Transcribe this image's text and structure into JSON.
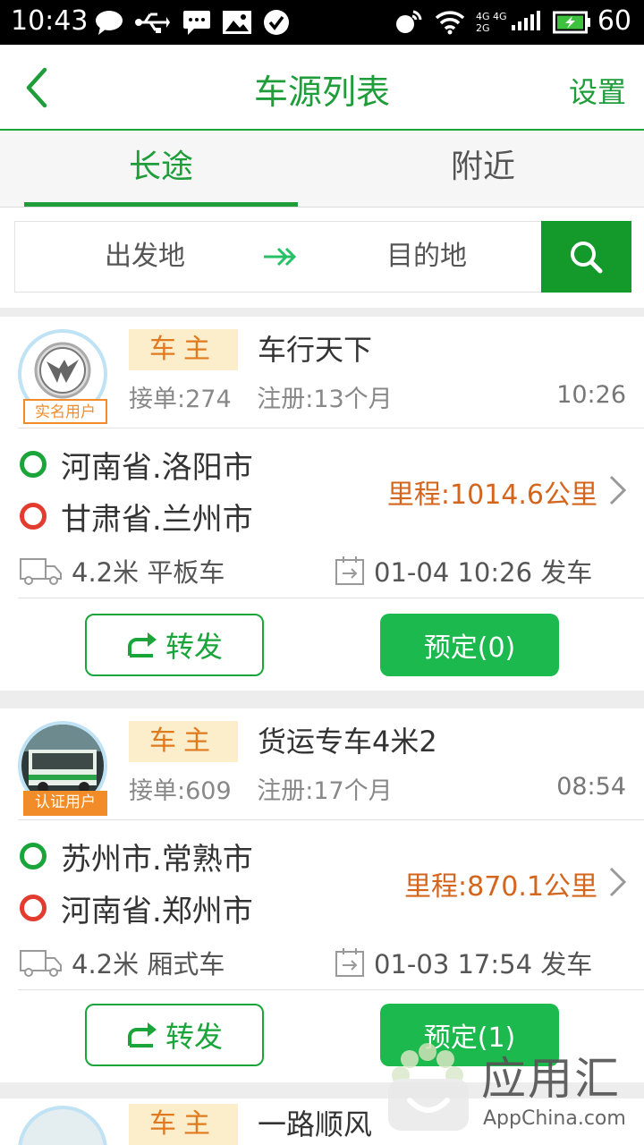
{
  "status_bar": {
    "time": "10:43",
    "battery_level": "60",
    "network_top": "4G 4G",
    "network_bottom": "2G"
  },
  "header": {
    "title": "车源列表",
    "settings_label": "设置",
    "back_icon": "chevron-left-icon"
  },
  "tabs": [
    {
      "label": "长途",
      "active": true
    },
    {
      "label": "附近",
      "active": false
    }
  ],
  "search": {
    "from_label": "出发地",
    "to_label": "目的地",
    "arrow_icon": "double-arrow-right-icon",
    "search_icon": "search-icon"
  },
  "listings": [
    {
      "badge": "实名用户",
      "role": "车主",
      "name": "车行天下",
      "orders": "接单:274",
      "registered": "注册:13个月",
      "time": "10:26",
      "from": "河南省.洛阳市",
      "to": "甘肃省.兰州市",
      "distance": "里程:1014.6公里",
      "vehicle": "4.2米 平板车",
      "departure": "01-04 10:26 发车",
      "forward_label": "转发",
      "book_label": "预定(0)"
    },
    {
      "badge": "认证用户",
      "role": "车主",
      "name": "货运专车4米2",
      "orders": "接单:609",
      "registered": "注册:17个月",
      "time": "08:54",
      "from": "苏州市.常熟市",
      "to": "河南省.郑州市",
      "distance": "里程:870.1公里",
      "vehicle": "4.2米 厢式车",
      "departure": "01-03 17:54 发车",
      "forward_label": "转发",
      "book_label": "预定(1)"
    },
    {
      "role": "车主",
      "name": "一路顺风"
    }
  ],
  "watermark": {
    "text_cn": "应用汇",
    "text_en": "AppChina.com"
  },
  "colors": {
    "brand_green": "#1f9d3a",
    "book_green": "#1cba4e",
    "accent_orange": "#e07a1f",
    "distance_orange": "#d4651d"
  }
}
